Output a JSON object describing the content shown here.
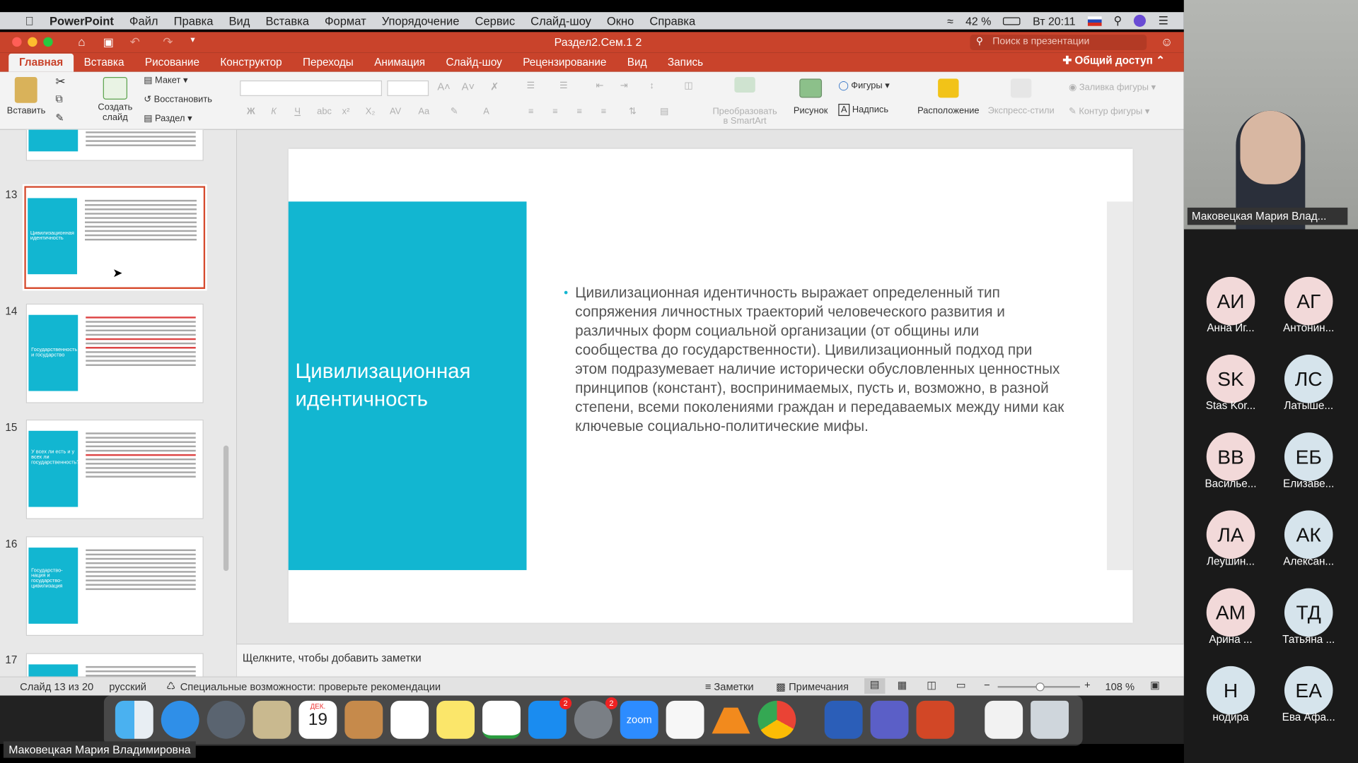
{
  "menubar": {
    "app": "PowerPoint",
    "items": [
      "Файл",
      "Правка",
      "Вид",
      "Вставка",
      "Формат",
      "Упорядочение",
      "Сервис",
      "Слайд-шоу",
      "Окно",
      "Справка"
    ],
    "battery": "42 %",
    "clock": "Вт 20:11"
  },
  "titlebar": {
    "doc_title": "Раздел2.Сем.1 2",
    "search_placeholder": "Поиск в презентации"
  },
  "tabs": {
    "items": [
      "Главная",
      "Вставка",
      "Рисование",
      "Конструктор",
      "Переходы",
      "Анимация",
      "Слайд-шоу",
      "Рецензирование",
      "Вид",
      "Запись"
    ],
    "share": "Общий доступ"
  },
  "ribbon": {
    "paste": "Вставить",
    "new_slide": "Создать слайд",
    "layout": "Макет",
    "reset": "Восстановить",
    "section": "Раздел",
    "smartart": "Преобразовать в SmartArt",
    "picture": "Рисунок",
    "shapes": "Фигуры",
    "textbox": "Надпись",
    "arrange": "Расположение",
    "quick_styles": "Экспресс-стили",
    "shape_fill": "Заливка фигуры",
    "shape_outline": "Контур фигуры"
  },
  "thumbnails": [
    {
      "num": "13",
      "title": "Цивилизационная идентичность"
    },
    {
      "num": "14",
      "title": "Государственность и государство"
    },
    {
      "num": "15",
      "title": "У всех ли есть и у всех ли государственность?"
    },
    {
      "num": "16",
      "title": "Государство-нация и государство-цивилизация"
    },
    {
      "num": "17",
      "title": ""
    }
  ],
  "slide": {
    "title": "Цивилизационная идентичность",
    "body": "Цивилизационная идентичность выражает определенный тип сопряжения личностных траекторий человеческого развития и различных форм социальной организации (от общины или сообщества до государственности). Цивилизационный подход при этом подразумевает наличие исторически обусловленных ценностных принципов (констант), воспринимаемых, пусть и, возможно, в разной степени, всеми поколениями граждан и передаваемых между ними как ключевые социально-политические мифы."
  },
  "notes": {
    "placeholder": "Щелкните, чтобы добавить заметки"
  },
  "status": {
    "slide_count": "Слайд 13 из 20",
    "language": "русский",
    "accessibility": "Специальные возможности: проверьте рекомендации",
    "notes_btn": "Заметки",
    "comments_btn": "Примечания",
    "zoom": "108 %"
  },
  "dock": {
    "calendar_month": "ДЕК.",
    "calendar_day": "19",
    "zoom_label": "zoom",
    "badge_appstore": "2",
    "badge_settings": "2"
  },
  "zoom_meeting": {
    "speaker": "Маковецкая Мария Влад...",
    "bottom_label": "Маковецкая Мария Владимировна",
    "participants": [
      {
        "initials": "АИ",
        "name": "Анна Иг..."
      },
      {
        "initials": "АГ",
        "name": "Антонин..."
      },
      {
        "initials": "SK",
        "name": "Stas Kor..."
      },
      {
        "initials": "ЛС",
        "name": "Латыше..."
      },
      {
        "initials": "ВВ",
        "name": "Василье..."
      },
      {
        "initials": "ЕБ",
        "name": "Елизаве..."
      },
      {
        "initials": "ЛА",
        "name": "Леушин..."
      },
      {
        "initials": "АК",
        "name": "Алексан..."
      },
      {
        "initials": "АМ",
        "name": "Арина ..."
      },
      {
        "initials": "ТД",
        "name": "Татьяна ..."
      },
      {
        "initials": "Н",
        "name": "нодира"
      },
      {
        "initials": "ЕА",
        "name": "Ева Афа..."
      }
    ]
  },
  "colors": {
    "accent": "#c9432b",
    "slide_teal": "#12b6d1"
  }
}
